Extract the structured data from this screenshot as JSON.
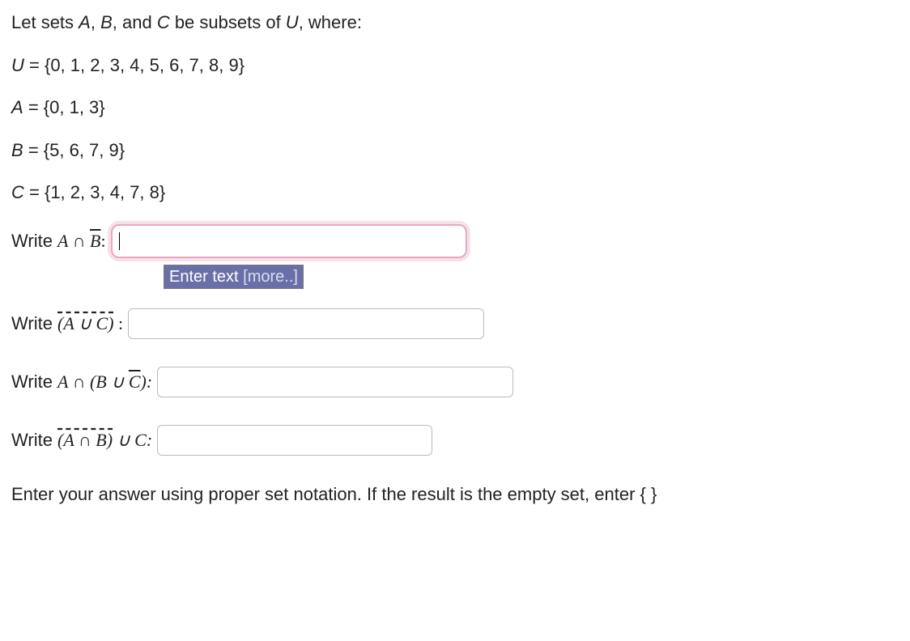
{
  "intro": "Let sets A, B, and C be subsets of U, where:",
  "sets": {
    "U_label": "U",
    "U_val": " = {0, 1, 2, 3, 4, 5, 6, 7, 8, 9}",
    "A_label": "A",
    "A_val": " = {0, 1, 3}",
    "B_label": "B",
    "B_val": " = {5, 6, 7, 9}",
    "C_label": "C",
    "C_val": " = {1, 2, 3, 4, 7, 8}"
  },
  "prompts": {
    "write": "Write ",
    "q1_prefix": "A ∩ ",
    "q1_over": "B",
    "q1_colon": ":",
    "q2_over": "(A ∪ C)",
    "q2_colon": " :",
    "q3_prefix": "A ∩ (B ∪ ",
    "q3_over": "C",
    "q3_suffix": "):",
    "q4_over": "(A ∩ B)",
    "q4_suffix": " ∪ C:"
  },
  "inputs": {
    "q1_value": "",
    "q2_value": "",
    "q3_value": "",
    "q4_value": ""
  },
  "tip": {
    "text": "Enter text ",
    "more": "[more..]"
  },
  "instructions": "Enter your answer using proper set notation. If the result is the empty set, enter { }"
}
